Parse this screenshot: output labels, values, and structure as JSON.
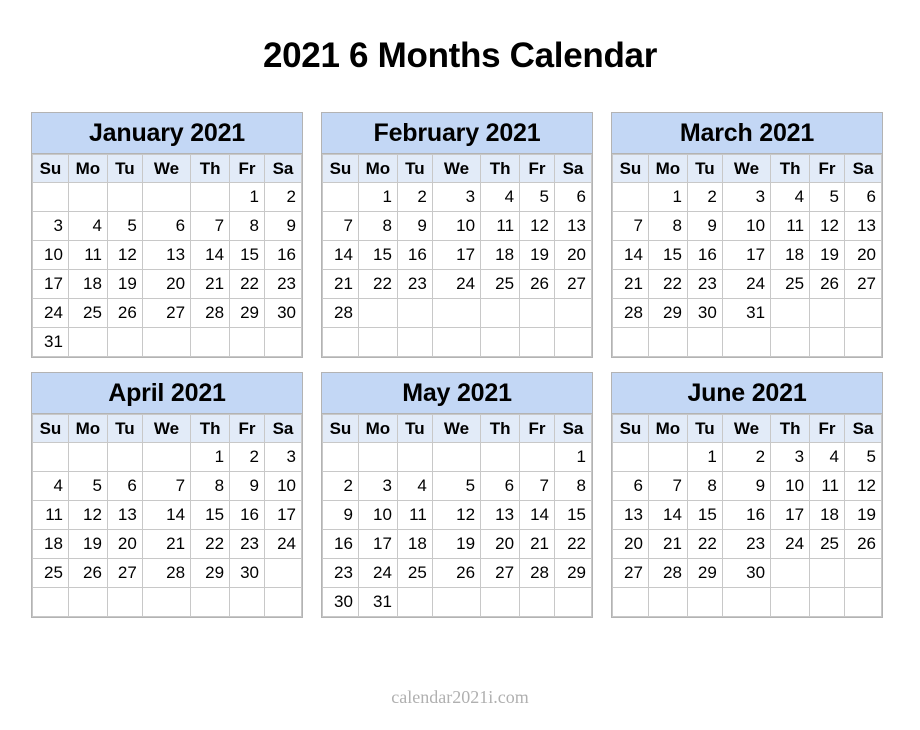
{
  "page": {
    "title": "2021 6 Months Calendar",
    "footer_credit": "calendar2021i.com",
    "colors": {
      "background": "#ffffff",
      "month_title_bg": "#c3d7f5",
      "weekday_header_bg": "#e2ebf8",
      "cell_bg": "#ffffff",
      "cell_border": "#c8c8c8",
      "block_border": "#b3b3b3",
      "text": "#000000",
      "footer_text": "#b0b0b0"
    }
  },
  "weekdays": [
    "Su",
    "Mo",
    "Tu",
    "We",
    "Th",
    "Fr",
    "Sa"
  ],
  "months": [
    {
      "name": "January 2021",
      "month": "January",
      "year": "2021",
      "weeks": [
        [
          "",
          "",
          "",
          "",
          "",
          "1",
          "2"
        ],
        [
          "3",
          "4",
          "5",
          "6",
          "7",
          "8",
          "9"
        ],
        [
          "10",
          "11",
          "12",
          "13",
          "14",
          "15",
          "16"
        ],
        [
          "17",
          "18",
          "19",
          "20",
          "21",
          "22",
          "23"
        ],
        [
          "24",
          "25",
          "26",
          "27",
          "28",
          "29",
          "30"
        ],
        [
          "31",
          "",
          "",
          "",
          "",
          "",
          ""
        ]
      ]
    },
    {
      "name": "February 2021",
      "month": "February",
      "year": "2021",
      "weeks": [
        [
          "",
          "1",
          "2",
          "3",
          "4",
          "5",
          "6"
        ],
        [
          "7",
          "8",
          "9",
          "10",
          "11",
          "12",
          "13"
        ],
        [
          "14",
          "15",
          "16",
          "17",
          "18",
          "19",
          "20"
        ],
        [
          "21",
          "22",
          "23",
          "24",
          "25",
          "26",
          "27"
        ],
        [
          "28",
          "",
          "",
          "",
          "",
          "",
          ""
        ],
        [
          "",
          "",
          "",
          "",
          "",
          "",
          ""
        ]
      ]
    },
    {
      "name": "March 2021",
      "month": "March",
      "year": "2021",
      "weeks": [
        [
          "",
          "1",
          "2",
          "3",
          "4",
          "5",
          "6"
        ],
        [
          "7",
          "8",
          "9",
          "10",
          "11",
          "12",
          "13"
        ],
        [
          "14",
          "15",
          "16",
          "17",
          "18",
          "19",
          "20"
        ],
        [
          "21",
          "22",
          "23",
          "24",
          "25",
          "26",
          "27"
        ],
        [
          "28",
          "29",
          "30",
          "31",
          "",
          "",
          ""
        ],
        [
          "",
          "",
          "",
          "",
          "",
          "",
          ""
        ]
      ]
    },
    {
      "name": "April 2021",
      "month": "April",
      "year": "2021",
      "weeks": [
        [
          "",
          "",
          "",
          "",
          "1",
          "2",
          "3"
        ],
        [
          "4",
          "5",
          "6",
          "7",
          "8",
          "9",
          "10"
        ],
        [
          "11",
          "12",
          "13",
          "14",
          "15",
          "16",
          "17"
        ],
        [
          "18",
          "19",
          "20",
          "21",
          "22",
          "23",
          "24"
        ],
        [
          "25",
          "26",
          "27",
          "28",
          "29",
          "30",
          ""
        ],
        [
          "",
          "",
          "",
          "",
          "",
          "",
          ""
        ]
      ]
    },
    {
      "name": "May 2021",
      "month": "May",
      "year": "2021",
      "weeks": [
        [
          "",
          "",
          "",
          "",
          "",
          "",
          "1"
        ],
        [
          "2",
          "3",
          "4",
          "5",
          "6",
          "7",
          "8"
        ],
        [
          "9",
          "10",
          "11",
          "12",
          "13",
          "14",
          "15"
        ],
        [
          "16",
          "17",
          "18",
          "19",
          "20",
          "21",
          "22"
        ],
        [
          "23",
          "24",
          "25",
          "26",
          "27",
          "28",
          "29"
        ],
        [
          "30",
          "31",
          "",
          "",
          "",
          "",
          ""
        ]
      ]
    },
    {
      "name": "June 2021",
      "month": "June",
      "year": "2021",
      "weeks": [
        [
          "",
          "",
          "1",
          "2",
          "3",
          "4",
          "5"
        ],
        [
          "6",
          "7",
          "8",
          "9",
          "10",
          "11",
          "12"
        ],
        [
          "13",
          "14",
          "15",
          "16",
          "17",
          "18",
          "19"
        ],
        [
          "20",
          "21",
          "22",
          "23",
          "24",
          "25",
          "26"
        ],
        [
          "27",
          "28",
          "29",
          "30",
          "",
          "",
          ""
        ],
        [
          "",
          "",
          "",
          "",
          "",
          "",
          ""
        ]
      ]
    }
  ]
}
